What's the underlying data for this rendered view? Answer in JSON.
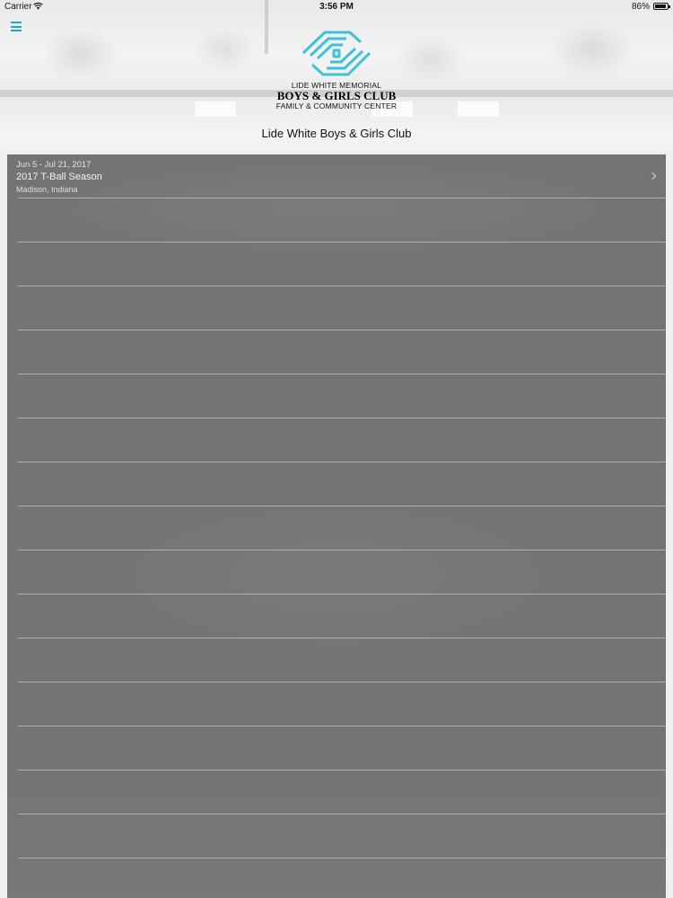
{
  "status_bar": {
    "carrier": "Carrier",
    "time": "3:56 PM",
    "battery": "86%"
  },
  "header": {
    "menu_icon": "hamburger-menu-icon",
    "logo": {
      "line1": "LIDE WHITE MEMORIAL",
      "line2": "BOYS & GIRLS CLUB",
      "line3": "FAMILY & COMMUNITY CENTER",
      "color": "#3fc1d8"
    },
    "title": "Lide White Boys & Girls Club"
  },
  "seasons": [
    {
      "dates": "Jun 5 - Jul 21, 2017",
      "name": "2017 T-Ball Season",
      "location": "Madison, Indiana"
    }
  ],
  "colors": {
    "accent": "#22a7c7",
    "panel": "#757475"
  }
}
